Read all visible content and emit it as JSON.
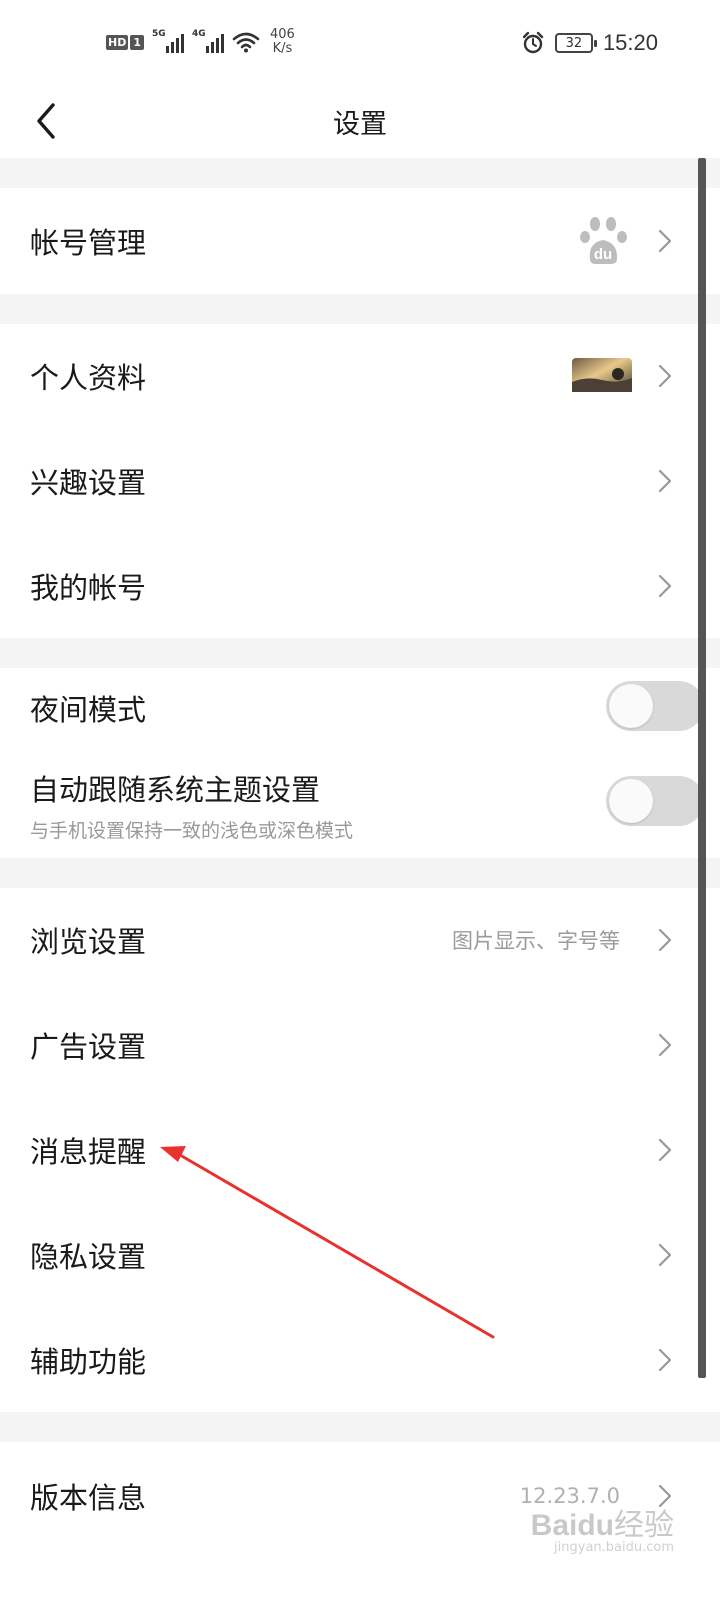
{
  "status_bar": {
    "hd": "HD",
    "sim": "1",
    "net1": "5G",
    "net2": "4G",
    "speed_value": "406",
    "speed_unit": "K/s",
    "battery": "32",
    "time": "15:20",
    "icons": [
      "signal-icon",
      "wifi-icon",
      "alarm-icon",
      "battery-icon"
    ]
  },
  "nav": {
    "title": "设置",
    "back_icon": "back-arrow-icon"
  },
  "sections": {
    "account": {
      "label": "帐号管理",
      "icon": "baidu-paw-icon"
    },
    "profile": {
      "items": [
        {
          "label": "个人资料",
          "thumbnail": "avatar-thumbnail"
        },
        {
          "label": "兴趣设置"
        },
        {
          "label": "我的帐号"
        }
      ]
    },
    "display": {
      "night_mode": {
        "label": "夜间模式",
        "on": false
      },
      "follow_system": {
        "label": "自动跟随系统主题设置",
        "sublabel": "与手机设置保持一致的浅色或深色模式",
        "on": false
      }
    },
    "general": {
      "items": [
        {
          "label": "浏览设置",
          "value": "图片显示、字号等"
        },
        {
          "label": "广告设置"
        },
        {
          "label": "消息提醒"
        },
        {
          "label": "隐私设置"
        },
        {
          "label": "辅助功能"
        }
      ]
    },
    "version": {
      "label": "版本信息",
      "value": "12.23.7.0"
    }
  },
  "watermark": {
    "brand": "Baidu",
    "suffix": "经验",
    "url": "jingyan.baidu.com"
  },
  "colors": {
    "background": "#ffffff",
    "section_gap": "#f4f4f4",
    "secondary_text": "#9b9b9b",
    "toggle_off": "#d9d9d9",
    "annotation_arrow": "#e8322e"
  }
}
